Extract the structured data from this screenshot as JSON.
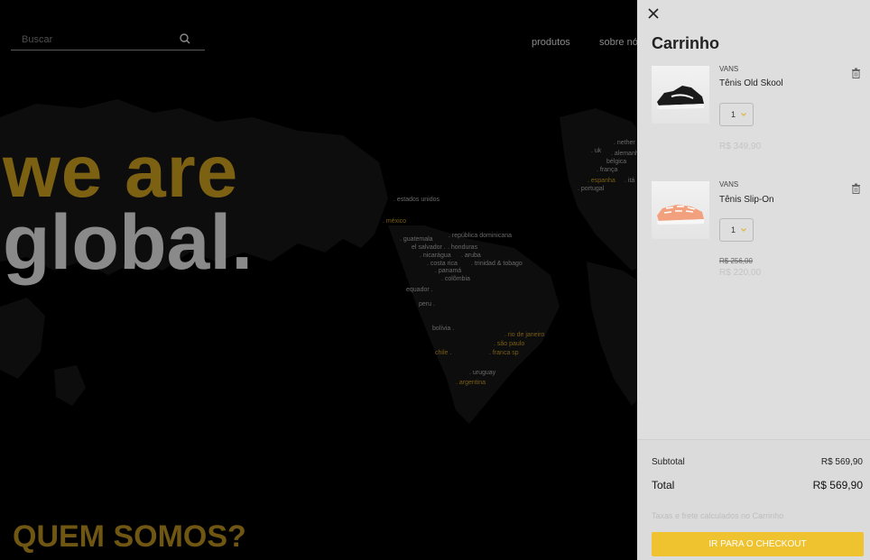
{
  "search": {
    "placeholder": "Buscar",
    "icon": "search-icon"
  },
  "nav": {
    "items": [
      "produtos",
      "sobre nós"
    ]
  },
  "hero": {
    "line1": "we are",
    "line2": "global.",
    "line1_color": "#7d6113",
    "line2_color": "#8a8a8a"
  },
  "about_heading": "QUEM SOMOS?",
  "map_labels": [
    {
      "text": ". estados unidos",
      "gold": false
    },
    {
      "text": ". méxico",
      "gold": true
    },
    {
      "text": ". república dominicana",
      "gold": false
    },
    {
      "text": ". guatemala",
      "gold": false
    },
    {
      "text": "el salvador .",
      "gold": false
    },
    {
      "text": ". honduras",
      "gold": false
    },
    {
      "text": ". nicarágua",
      "gold": false
    },
    {
      "text": ". aruba",
      "gold": false
    },
    {
      "text": ". costa rica",
      "gold": false
    },
    {
      "text": ". trinidad & tobago",
      "gold": false
    },
    {
      "text": ". panamá",
      "gold": false
    },
    {
      "text": ". colômbia",
      "gold": false
    },
    {
      "text": "equador .",
      "gold": false
    },
    {
      "text": "peru .",
      "gold": false
    },
    {
      "text": "bolívia .",
      "gold": false
    },
    {
      "text": ". rio de janeiro",
      "gold": true
    },
    {
      "text": ". são paulo",
      "gold": true
    },
    {
      "text": "chile .",
      "gold": true
    },
    {
      "text": ". franca sp",
      "gold": true
    },
    {
      "text": ". uruguay",
      "gold": false
    },
    {
      "text": ". argentina",
      "gold": true
    },
    {
      "text": ". nether",
      "gold": false
    },
    {
      "text": ". uk",
      "gold": false
    },
    {
      "text": ". alemanh",
      "gold": false
    },
    {
      "text": "bélgica",
      "gold": false
    },
    {
      "text": ". frança",
      "gold": false
    },
    {
      "text": ". espanha",
      "gold": true
    },
    {
      "text": ". itá",
      "gold": false
    },
    {
      "text": ". portugal",
      "gold": false
    }
  ],
  "cart": {
    "title": "Carrinho",
    "items": [
      {
        "brand": "VANS",
        "name": "Tênis Old Skool",
        "qty": "1",
        "price": "R$ 349,90",
        "old_price": ""
      },
      {
        "brand": "VANS",
        "name": "Tênis Slip-On",
        "qty": "1",
        "price": "R$ 220,00",
        "old_price": "R$ 256,00"
      }
    ],
    "subtotal_label": "Subtotal",
    "subtotal_value": "R$ 569,90",
    "total_label": "Total",
    "total_value": "R$ 569,90",
    "taxes_note": "Taxas e frete calculados no Carrinho",
    "checkout_label": "IR PARA O CHECKOUT",
    "accent_color": "#efc230"
  }
}
